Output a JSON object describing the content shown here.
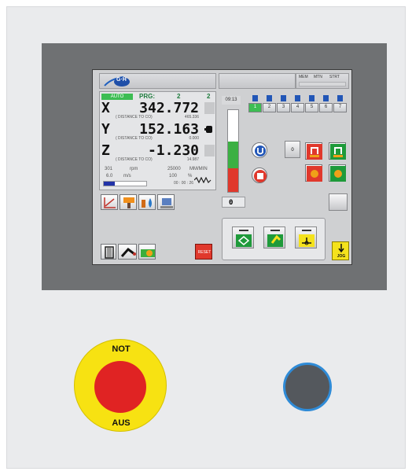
{
  "header": {
    "logo": "G·H",
    "mem": "MEM",
    "mtn": "MTN",
    "strt": "STRT"
  },
  "status": {
    "mode": "AUTO",
    "prg_label": "PRG:",
    "prg_value": "2",
    "prg_value2": "2"
  },
  "axes": [
    {
      "name": "X",
      "value": "342.772",
      "dist_label": "( DISTANCE TO CO)",
      "dist_value": "465.336"
    },
    {
      "name": "Y",
      "value": "152.163",
      "dist_label": "( DISTANCE TO CO)",
      "dist_value": "0.000"
    },
    {
      "name": "Z",
      "value": "-1.230",
      "dist_label": "( DISTANCE TO CO)",
      "dist_value": "14.987"
    }
  ],
  "spindle": {
    "num": "301",
    "unit": "rpm",
    "feed": "25000",
    "feed_unit": "MM/MIN",
    "speed": "6.0",
    "speed_unit": "m/s",
    "pct": "100",
    "pct_unit": "%",
    "time": "00 : 00 : 26"
  },
  "time_readout": "09:13",
  "bar_level": 0.62,
  "counter": "0",
  "tool_tabs": [
    "1",
    "2",
    "3",
    "4",
    "5",
    "6",
    "7"
  ],
  "small_box": "0",
  "reset_label": "RESET",
  "jog_label": "JOG",
  "estop": {
    "top": "NOT",
    "bottom": "AUS"
  },
  "colors": {
    "green": "#1e9a3a",
    "red": "#e0382c",
    "yellow": "#f4e21c",
    "blue": "#2256b7"
  }
}
